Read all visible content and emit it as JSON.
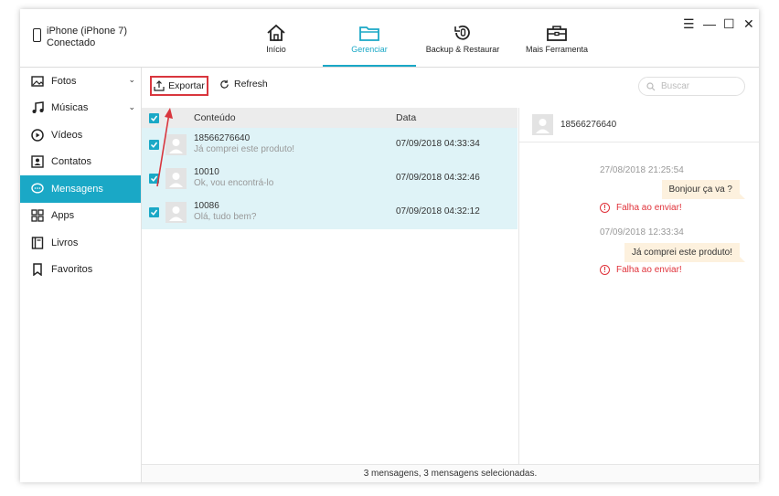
{
  "device": {
    "name": "iPhone (iPhone 7)",
    "status": "Conectado"
  },
  "nav": {
    "tabs": [
      {
        "label": "Início",
        "icon": "home-icon"
      },
      {
        "label": "Gerenciar",
        "icon": "folder-icon",
        "active": true
      },
      {
        "label": "Backup & Restaurar",
        "icon": "backup-restore-icon"
      },
      {
        "label": "Mais Ferramenta",
        "icon": "toolbox-icon"
      }
    ]
  },
  "window_controls": {
    "menu": "☰",
    "minimize": "—",
    "maximize": "☐",
    "close": "✕"
  },
  "sidebar": {
    "items": [
      {
        "label": "Fotos",
        "icon": "photo-icon",
        "expandable": true
      },
      {
        "label": "Músicas",
        "icon": "music-icon",
        "expandable": true
      },
      {
        "label": "Vídeos",
        "icon": "video-icon"
      },
      {
        "label": "Contatos",
        "icon": "contacts-icon"
      },
      {
        "label": "Mensagens",
        "icon": "message-icon",
        "active": true
      },
      {
        "label": "Apps",
        "icon": "apps-icon"
      },
      {
        "label": "Livros",
        "icon": "book-icon"
      },
      {
        "label": "Favoritos",
        "icon": "bookmark-icon"
      }
    ]
  },
  "toolbar": {
    "export_label": "Exportar",
    "refresh_label": "Refresh",
    "search_placeholder": "Buscar"
  },
  "list": {
    "columns": {
      "content": "Conteúdo",
      "date": "Data"
    },
    "rows": [
      {
        "name": "18566276640",
        "preview": "Já comprei este produto!",
        "date": "07/09/2018 04:33:34",
        "checked": true
      },
      {
        "name": "10010",
        "preview": "Ok, vou encontrá-lo",
        "date": "07/09/2018 04:32:46",
        "checked": true
      },
      {
        "name": "10086",
        "preview": "Olá, tudo bem?",
        "date": "07/09/2018 04:32:12",
        "checked": true
      }
    ]
  },
  "detail": {
    "contact": "18566276640",
    "messages": [
      {
        "timestamp": "27/08/2018 21:25:54",
        "text": "Bonjour ça va ?",
        "error": "Falha ao enviar!"
      },
      {
        "timestamp": "07/09/2018 12:33:34",
        "text": "Já comprei este produto!",
        "error": "Falha ao enviar!"
      }
    ]
  },
  "status_bar": {
    "text": "3 mensagens, 3 mensagens selecionadas."
  },
  "colors": {
    "accent": "#1aa8c6",
    "row_selected": "#dff3f7",
    "bubble": "#fdf1de",
    "error": "#e0323a",
    "highlight_box": "#d9363e"
  }
}
